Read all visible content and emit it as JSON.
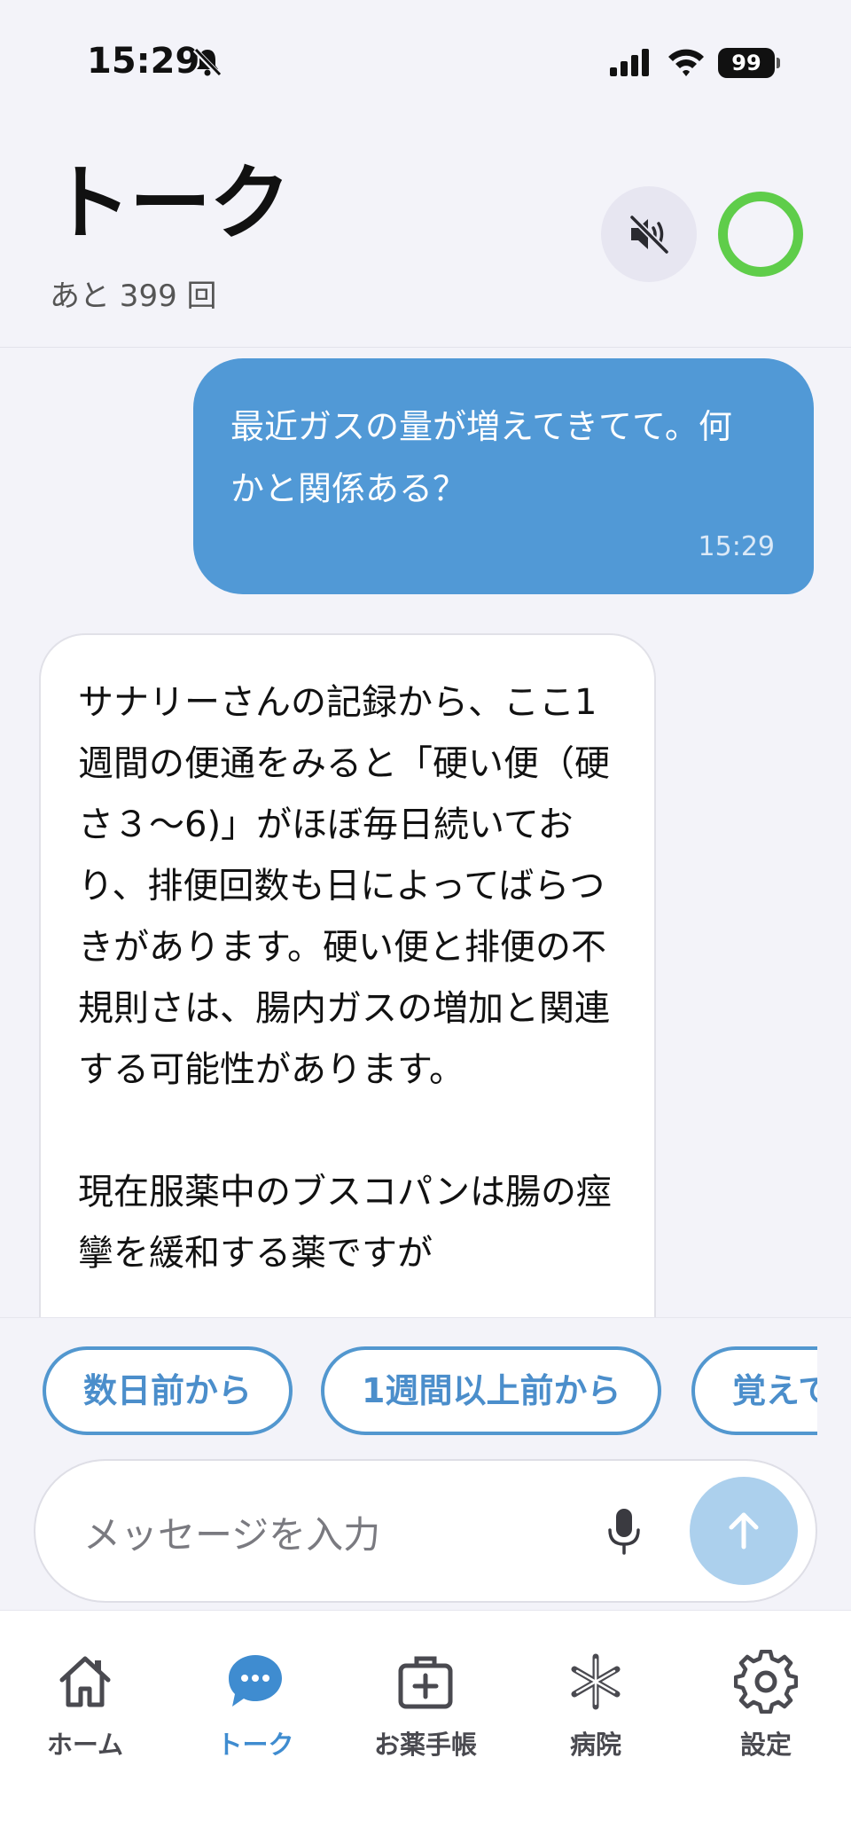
{
  "status_bar": {
    "time": "15:29",
    "battery": "99"
  },
  "header": {
    "title": "トーク",
    "remaining": "あと 399 回"
  },
  "messages": [
    {
      "role": "user",
      "text": "最近ガスの量が増えてきてて。何かと関係ある？",
      "time": "15:29"
    },
    {
      "role": "assistant",
      "text": "サナリーさんの記録から、ここ1週間の便通をみると「硬い便（硬さ３〜6)」がほぼ毎日続いており、排便回数も日によってばらつきがあります。硬い便と排便の不規則さは、腸内ガスの増加と関連する可能性があります。\n\n現在服薬中のブスコパンは腸の痙攣を緩和する薬ですが"
    }
  ],
  "suggestions": [
    "数日前から",
    "1週間以上前から",
    "覚えてない"
  ],
  "composer": {
    "placeholder": "メッセージを入力"
  },
  "tabs": [
    {
      "label": "ホーム",
      "icon": "home-icon",
      "active": false
    },
    {
      "label": "トーク",
      "icon": "chat-bubble-icon",
      "active": true
    },
    {
      "label": "お薬手帳",
      "icon": "medicine-notebook-icon",
      "active": false
    },
    {
      "label": "病院",
      "icon": "hospital-icon",
      "active": false
    },
    {
      "label": "設定",
      "icon": "gear-icon",
      "active": false
    }
  ],
  "colors": {
    "accent": "#3f8cd0",
    "user_bubble": "#5199d6",
    "status_ring": "#5fcd4a",
    "send_disabled": "#acd0ed"
  }
}
